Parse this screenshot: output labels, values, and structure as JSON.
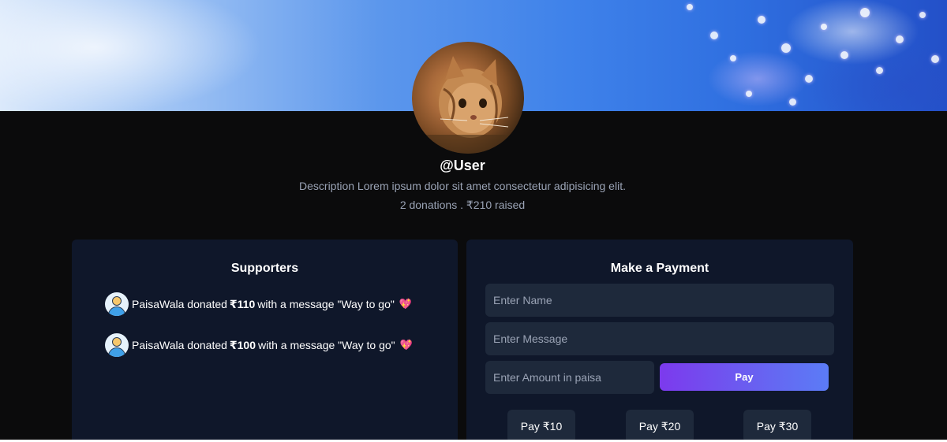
{
  "profile": {
    "username": "@User",
    "description": "Description Lorem ipsum dolor sit amet consectetur adipisicing elit.",
    "stats": "2 donations . ₹210 raised"
  },
  "supporters": {
    "title": "Supporters",
    "items": [
      {
        "name": "PaisaWala",
        "verb": "donated",
        "amount": "₹110",
        "suffix": "with a message \"Way to go\"",
        "emoji": "💖"
      },
      {
        "name": "PaisaWala",
        "verb": "donated",
        "amount": "₹100",
        "suffix": "with a message \"Way to go\"",
        "emoji": "💖"
      }
    ]
  },
  "payment": {
    "title": "Make a Payment",
    "name_placeholder": "Enter Name",
    "message_placeholder": "Enter Message",
    "amount_placeholder": "Enter Amount in paisa",
    "pay_label": "Pay",
    "quick_buttons": [
      "Pay ₹10",
      "Pay ₹20",
      "Pay ₹30"
    ]
  },
  "colors": {
    "page_bg": "#0b0b0c",
    "panel_bg": "#0f172a",
    "field_bg": "#1e293b",
    "pay_gradient_start": "#7c3aed",
    "pay_gradient_end": "#5b7cf6"
  },
  "icons": {
    "supporter_avatar": "user-avatar-icon",
    "heart": "sparkling-heart-emoji"
  }
}
